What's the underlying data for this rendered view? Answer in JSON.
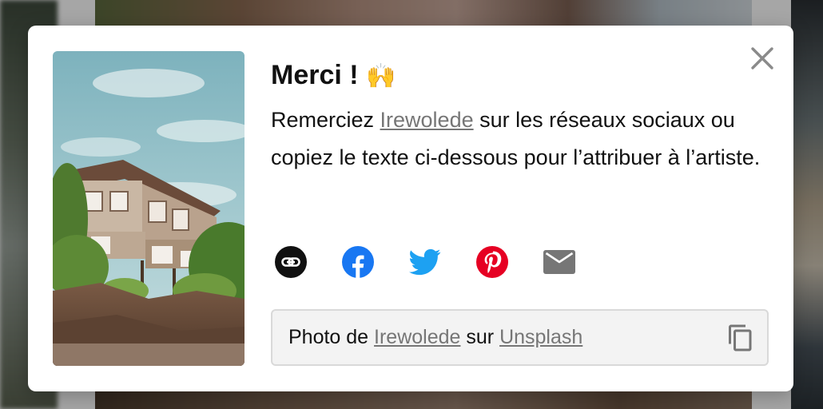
{
  "modal": {
    "title": "Merci !",
    "title_emoji": "🙌",
    "description": {
      "before": "Remerciez ",
      "author_link": "Irewolede",
      "after": " sur les réseaux sociaux ou copiez le texte ci-dessous pour l’attribuer à l’artiste."
    },
    "socials": [
      {
        "name": "link-icon"
      },
      {
        "name": "facebook-icon",
        "color": "#1877f2"
      },
      {
        "name": "twitter-icon",
        "color": "#1da1f2"
      },
      {
        "name": "pinterest-icon",
        "color": "#e60023"
      },
      {
        "name": "email-icon",
        "color": "#767676"
      }
    ],
    "caption": {
      "prefix": "Photo de ",
      "author": "Irewolede",
      "middle": " sur ",
      "site": "Unsplash"
    }
  },
  "colors": {
    "link": "#767676",
    "text": "#111111",
    "caption_bg": "#f3f3f3",
    "caption_border": "#d9d9d9"
  }
}
